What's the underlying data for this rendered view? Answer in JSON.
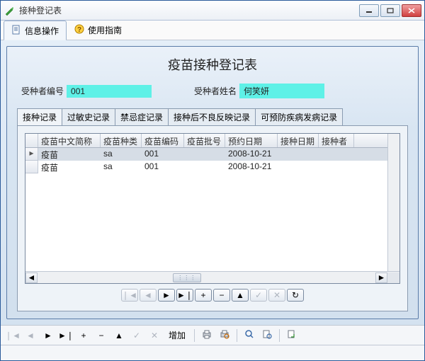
{
  "window": {
    "title": "接种登记表"
  },
  "toolbar": {
    "tabs": [
      {
        "label": "信息操作",
        "icon": "document-icon"
      },
      {
        "label": "使用指南",
        "icon": "help-icon"
      }
    ]
  },
  "page": {
    "title": "疫苗接种登记表"
  },
  "form": {
    "id_label": "受种者编号",
    "id_value": "001",
    "name_label": "受种者姓名",
    "name_value": "何笑妍"
  },
  "subtabs": [
    "接种记录",
    "过敏史记录",
    "禁忌症记录",
    "接种后不良反映记录",
    "可预防疾病发病记录"
  ],
  "grid": {
    "columns": [
      "疫苗中文简称",
      "疫苗种类",
      "疫苗编码",
      "疫苗批号",
      "预约日期",
      "接种日期",
      "接种者"
    ],
    "rows": [
      {
        "selected": true,
        "cells": [
          "疫苗",
          "sa",
          "001",
          "",
          "2008-10-21",
          "",
          ""
        ]
      },
      {
        "selected": false,
        "cells": [
          "疫苗",
          "sa",
          "001",
          "",
          "2008-10-21",
          "",
          ""
        ]
      }
    ]
  },
  "bottom": {
    "add_label": "增加"
  },
  "glyphs": {
    "first": "❘◄",
    "prev": "◄",
    "next": "►",
    "last": "►❘",
    "plus": "+",
    "minus": "−",
    "up": "▲",
    "check": "✓",
    "x": "✕",
    "refresh": "↻"
  }
}
